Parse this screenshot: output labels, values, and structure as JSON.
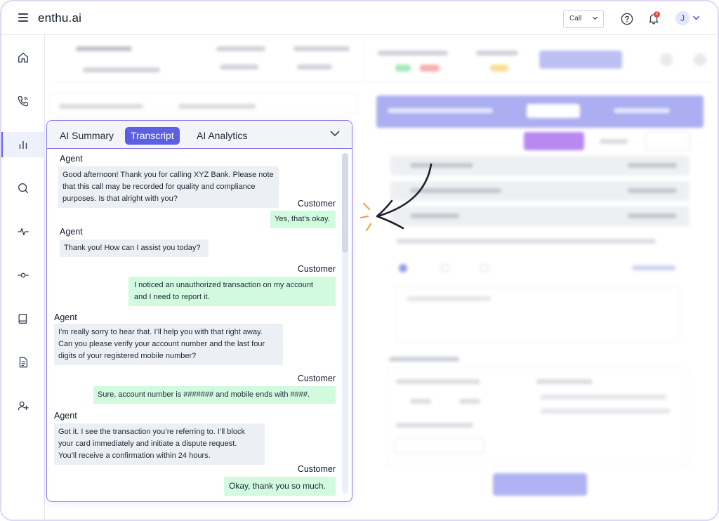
{
  "app": {
    "brand": "enthu.ai"
  },
  "topbar": {
    "call_select": "Call",
    "notifications_count": "2",
    "avatar_letter": "J"
  },
  "sidebar": {
    "items": [
      "home-icon",
      "phone-icon",
      "analytics-icon",
      "search-icon",
      "activity-icon",
      "commit-icon",
      "book-icon",
      "document-icon",
      "add-user-icon"
    ],
    "active": "analytics-icon"
  },
  "panel": {
    "tabs": [
      {
        "label": "AI Summary"
      },
      {
        "label": "Transcript"
      },
      {
        "label": "AI Analytics"
      }
    ],
    "active_tab": "Transcript",
    "messages": [
      {
        "speaker": "Agent",
        "lines": [
          "Good afternoon! Thank you for calling XYZ Bank. Please note",
          "that this call may be recorded for quality and compliance",
          "purposes. Is that alright with you?"
        ]
      },
      {
        "speaker": "Customer",
        "lines": [
          "Yes, that’s okay."
        ]
      },
      {
        "speaker": "Agent",
        "lines": [
          "Thank you! How can I assist you today?"
        ]
      },
      {
        "speaker": "Customer",
        "lines": [
          "I noticed an unauthorized transaction on my account",
          "and I need to report it."
        ]
      },
      {
        "speaker": "Agent",
        "lines": [
          "I’m really sorry to hear that. I’ll help you with that right away.",
          "Can you please verify your account number and the last four",
          "digits of your registered mobile number?"
        ]
      },
      {
        "speaker": "Customer",
        "lines": [
          "Sure, account number is ####### and mobile ends with ####."
        ]
      },
      {
        "speaker": "Agent",
        "lines": [
          "Got it. I see the transaction you’re referring to. I’ll block",
          "your card immediately and initiate a dispute request.",
          "You’ll receive a confirmation within 24 hours."
        ]
      },
      {
        "speaker": "Customer",
        "lines": [
          "Okay, thank you so much."
        ]
      }
    ]
  },
  "colors": {
    "accent": "#5b5fe0",
    "agent_bubble": "#eceff3",
    "customer_bubble": "#d1fadf",
    "panel_border": "#8b7de8",
    "arrow_spark": "#f6a04d"
  }
}
